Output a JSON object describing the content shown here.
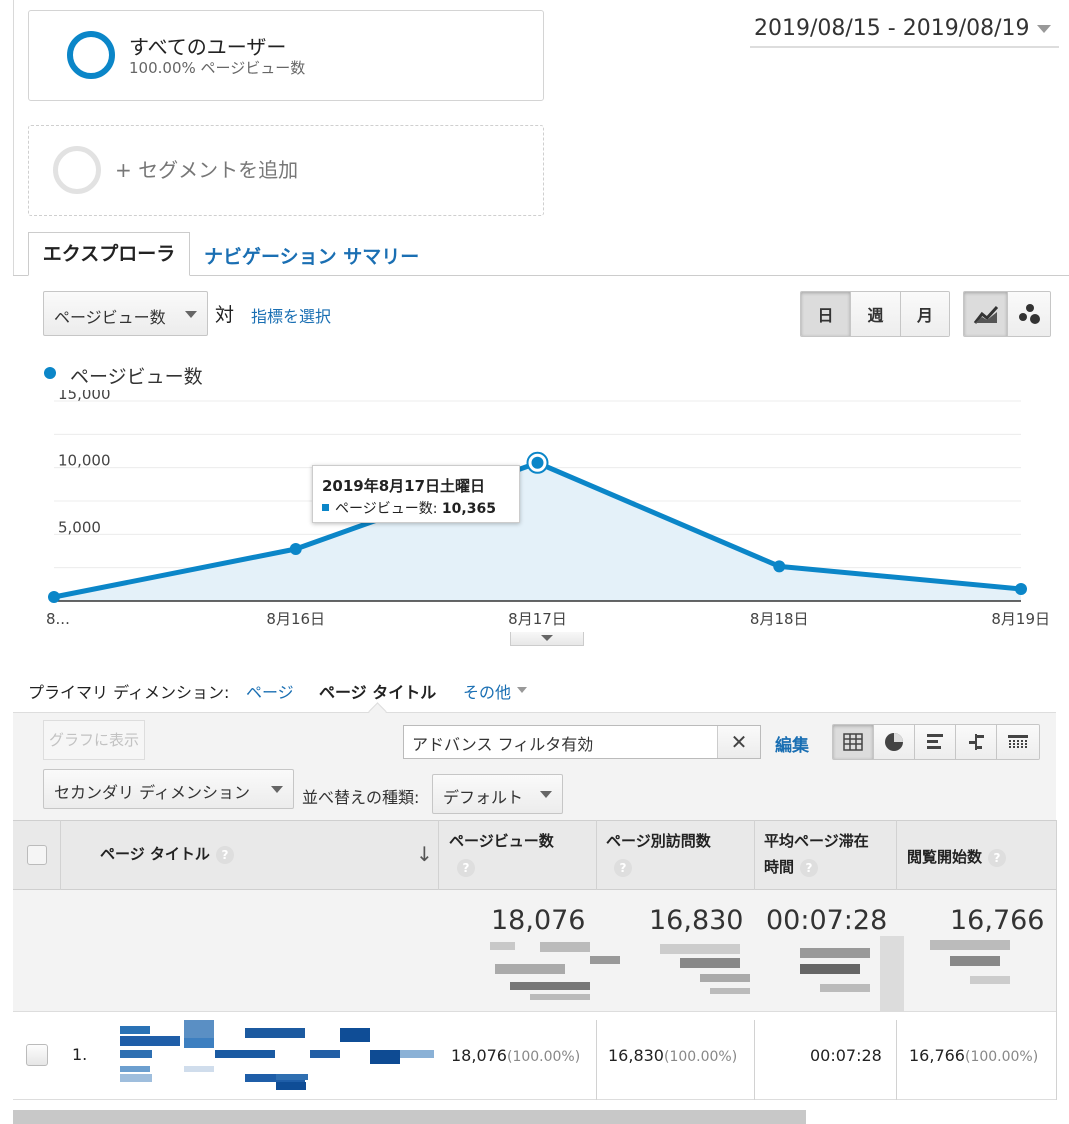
{
  "segments": {
    "all_users": {
      "title": "すべてのユーザー",
      "subtitle": "100.00% ページビュー数",
      "color": "#0b86c8"
    },
    "add_segment": {
      "label": "+ セグメントを追加"
    }
  },
  "date_range": "2019/08/15 - 2019/08/19",
  "tabs": {
    "explorer": "エクスプローラ",
    "navigation_summary": "ナビゲーション サマリー"
  },
  "chart_controls": {
    "metric_dropdown": "ページビュー数",
    "vs_label": "対",
    "select_metric_link": "指標を選択",
    "granularity": [
      {
        "label": "日",
        "active": true
      },
      {
        "label": "週",
        "active": false
      },
      {
        "label": "月",
        "active": false
      }
    ],
    "chart_type_icons": [
      "line-chart-icon",
      "motion-chart-icon"
    ]
  },
  "chart_data": {
    "type": "area",
    "series": [
      {
        "name": "ページビュー数",
        "color": "#0b86c8",
        "values": [
          300,
          3900,
          10365,
          2600,
          900
        ]
      }
    ],
    "x_labels": [
      "8...",
      "8月16日",
      "8月17日",
      "8月18日",
      "8月19日"
    ],
    "y_ticks": [
      "15,000",
      "10,000",
      "5,000"
    ],
    "ylim": [
      0,
      15000
    ],
    "grid": true,
    "highlight_index": 2,
    "tooltip": {
      "date": "2019年8月17日土曜日",
      "metric": "ページビュー数",
      "value": "10,365"
    }
  },
  "primary_dimension": {
    "label": "プライマリ ディメンション:",
    "options": [
      {
        "label": "ページ",
        "active": false
      },
      {
        "label": "ページ タイトル",
        "active": true
      },
      {
        "label": "その他",
        "active": false
      }
    ]
  },
  "toolbar": {
    "plot_rows": "グラフに表示",
    "filter_text": "アドバンス フィルタ有効",
    "filter_clear": "✕",
    "edit": "編集",
    "view_icons": [
      "table-view-icon",
      "pie-view-icon",
      "performance-view-icon",
      "comparison-view-icon",
      "pivot-view-icon"
    ],
    "secondary_dimension": "セカンダリ ディメンション",
    "sort_label": "並べ替えの種類:",
    "sort_value": "デフォルト"
  },
  "table": {
    "columns": {
      "title": "ページ タイトル",
      "pageviews": "ページビュー数",
      "unique": "ページ別訪問数",
      "avg_time_1": "平均ページ滞在",
      "avg_time_2": "時間",
      "entrances": "閲覧開始数"
    },
    "help": "?",
    "sort_arrow": "↓",
    "totals": {
      "pageviews": "18,076",
      "unique": "16,830",
      "avg_time": "00:07:28",
      "entrances": "16,766"
    },
    "rows": [
      {
        "index": "1.",
        "pageviews": "18,076",
        "pageviews_pct": "(100.00%)",
        "unique": "16,830",
        "unique_pct": "(100.00%)",
        "avg_time": "00:07:28",
        "entrances": "16,766",
        "entrances_pct": "(100.00%)"
      }
    ]
  }
}
